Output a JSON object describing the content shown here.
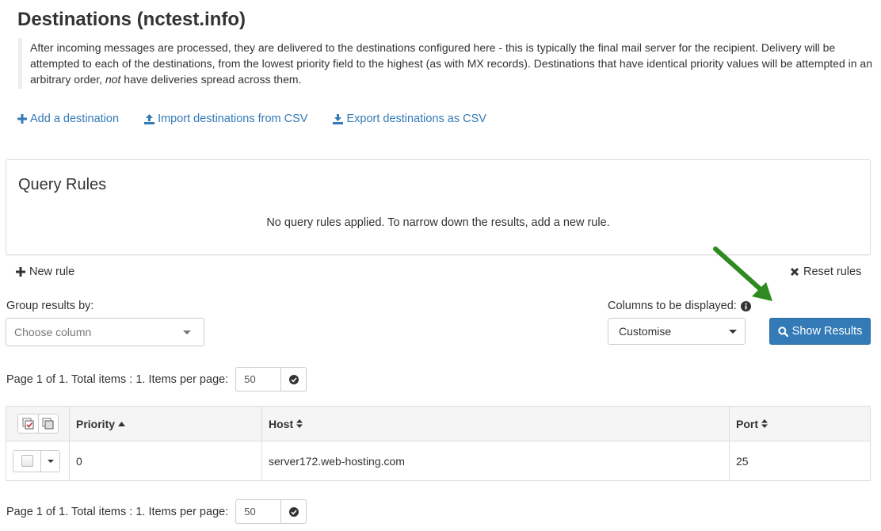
{
  "page": {
    "title": "Destinations (nctest.info)",
    "intro_part1": "After incoming messages are processed, they are delivered to the destinations configured here - this is typically the final mail server for the recipient. Delivery will be attempted to each of the destinations, from the lowest priority field to the highest (as with MX records). Destinations that have identical priority values will be attempted in an arbitrary order, ",
    "intro_em": "not",
    "intro_part2": " have deliveries spread across them."
  },
  "actions": {
    "add": "Add a destination",
    "import": "Import destinations from CSV",
    "export": "Export destinations as CSV"
  },
  "query_rules": {
    "title": "Query Rules",
    "empty_message": "No query rules applied. To narrow down the results, add a new rule.",
    "new_rule": "New rule",
    "reset_rules": "Reset rules"
  },
  "controls": {
    "group_label": "Group results by:",
    "group_placeholder": "Choose column",
    "columns_label": "Columns to be displayed:",
    "columns_value": "Customise",
    "show_results": "Show Results"
  },
  "pager": {
    "text": "Page 1 of 1. Total items : 1. Items per page:",
    "per_page": "50"
  },
  "table": {
    "headers": [
      "Priority",
      "Host",
      "Port"
    ],
    "rows": [
      {
        "priority": "0",
        "host": "server172.web-hosting.com",
        "port": "25"
      }
    ]
  },
  "colors": {
    "primary": "#337ab7",
    "arrow": "#2e8b1f"
  }
}
